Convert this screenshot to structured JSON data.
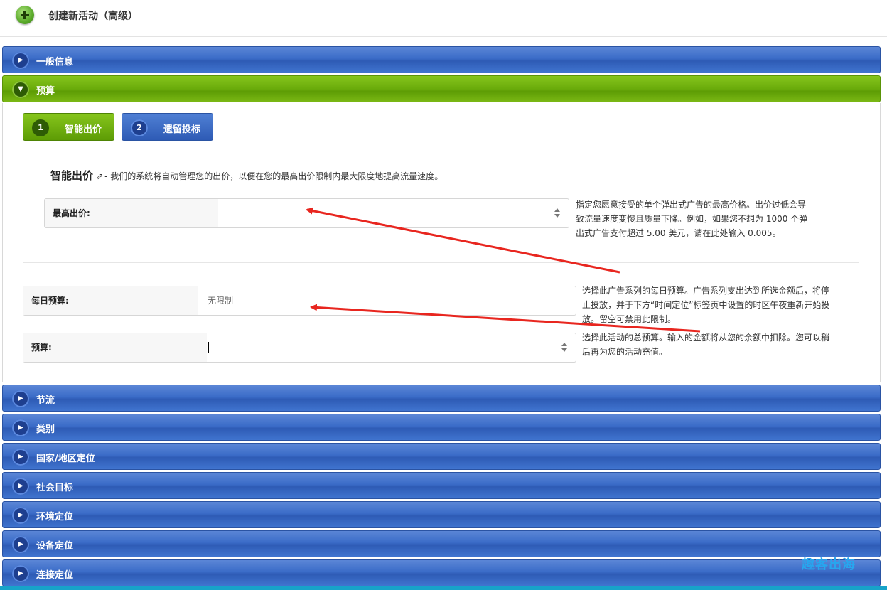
{
  "header": {
    "title": "创建新活动（高级）",
    "icon": "add-circle-icon"
  },
  "sections": {
    "general": {
      "label": "一般信息",
      "icon": "play-icon"
    },
    "budget": {
      "label": "预算",
      "icon": "chevron-down-icon"
    },
    "throttle": {
      "label": "节流"
    },
    "category": {
      "label": "类别"
    },
    "geo": {
      "label": "国家/地区定位"
    },
    "social": {
      "label": "社会目标"
    },
    "environment": {
      "label": "环境定位"
    },
    "device": {
      "label": "设备定位"
    },
    "connection": {
      "label": "连接定位"
    }
  },
  "budget_tabs": [
    {
      "num": "1",
      "label": "智能出价",
      "active": true
    },
    {
      "num": "2",
      "label": "遗留投标",
      "active": false
    }
  ],
  "smart_bid": {
    "title": "智能出价",
    "description": "- 我们的系统将自动管理您的出价，以便在您的最高出价限制内最大限度地提高流量速度。",
    "max_bid_label": "最高出价:",
    "max_bid_value": "",
    "max_bid_help_1": "指定您愿意接受的单个弹出式广告的最高价格。出价过低会导",
    "max_bid_help_2": "致流量速度变慢且质量下降。例如，如果您不想为 1000 个弹",
    "max_bid_help_3": "出式广告支付超过 5.00 美元，请在此处输入 0.005。"
  },
  "daily_budget": {
    "label": "每日预算:",
    "value": "无限制",
    "help_1": "选择此广告系列的每日预算。广告系列支出达到所选金额后，将停",
    "help_2": "止投放，并于下方“时间定位”标签页中设置的时区午夜重新开始投",
    "help_3": "放。留空可禁用此限制。"
  },
  "total_budget": {
    "label": "预算:",
    "value": "",
    "help_1": "选择此活动的总预算。输入的金额将从您的余额中扣除。您可以稍",
    "help_2": "后再为您的活动充值。"
  },
  "watermark": "趣客出海",
  "colors": {
    "blue_bar": "#3b6cc8",
    "green_bar": "#6aab0b",
    "arrow": "#e8261f"
  }
}
